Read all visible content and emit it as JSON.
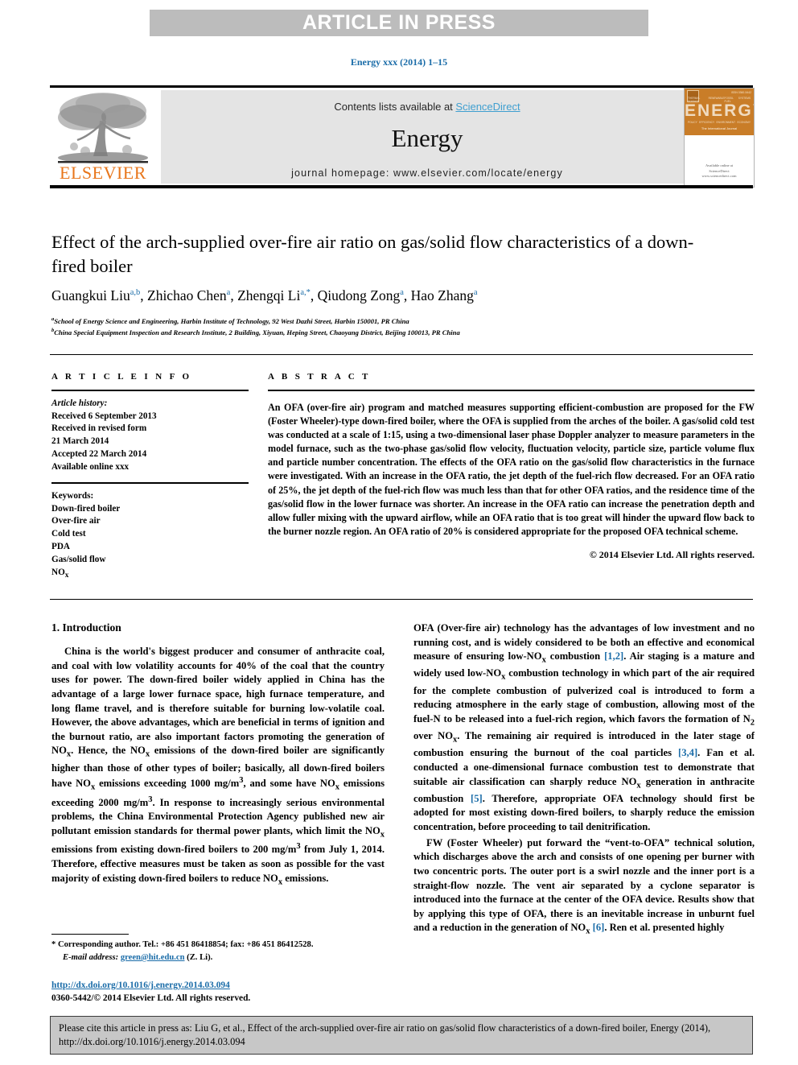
{
  "banner": {
    "label": "ARTICLE IN PRESS"
  },
  "running_head": "Energy xxx (2014) 1–15",
  "masthead": {
    "contents_prefix": "Contents lists available at ",
    "sciencedirect": "ScienceDirect",
    "journal_name": "Energy",
    "homepage": "journal homepage: www.elsevier.com/locate/energy",
    "publisher_wordmark": "ELSEVIER",
    "cover": {
      "title_word": "ENERGY",
      "subtitle": "The International Journal",
      "corner_label": "ISSN 0360-5442",
      "top_row": [
        "THERMAL SCIENCE",
        "RENEWABLE",
        "FOSSIL FUEL",
        "SYSTEMS"
      ],
      "bottom_row": [
        "POLICY",
        "EFFICIENCY",
        "ENVIRONMENT",
        "ECONOMY"
      ],
      "publisher_lines": "Available online at\nScienceDirect\nwww.sciencedirect.com"
    }
  },
  "article": {
    "title": "Effect of the arch-supplied over-fire air ratio on gas/solid flow characteristics of a down-fired boiler",
    "authors": [
      {
        "name": "Guangkui Liu",
        "marks": "a,b",
        "sep": ", "
      },
      {
        "name": "Zhichao Chen",
        "marks": "a",
        "sep": ", "
      },
      {
        "name": "Zhengqi Li",
        "marks": "a,*",
        "sep": ", "
      },
      {
        "name": "Qiudong Zong",
        "marks": "a",
        "sep": ", "
      },
      {
        "name": "Hao Zhang",
        "marks": "a",
        "sep": ""
      }
    ],
    "affiliations": [
      {
        "mark": "a",
        "text": "School of Energy Science and Engineering, Harbin Institute of Technology, 92 West Dazhi Street, Harbin 150001, PR China"
      },
      {
        "mark": "b",
        "text": "China Special Equipment Inspection and Research Institute, 2 Building, Xiyuan, Heping Street, Chaoyang District, Beijing 100013, PR China"
      }
    ]
  },
  "article_info": {
    "heading": "A R T I C L E   I N F O",
    "history_label": "Article history:",
    "history": [
      "Received 6 September 2013",
      "Received in revised form",
      "21 March 2014",
      "Accepted 22 March 2014",
      "Available online xxx"
    ],
    "keywords_label": "Keywords:",
    "keywords": [
      "Down-fired boiler",
      "Over-fire air",
      "Cold test",
      "PDA",
      "Gas/solid flow",
      "NOx"
    ]
  },
  "abstract": {
    "heading": "A B S T R A C T",
    "text": "An OFA (over-fire air) program and matched measures supporting efficient-combustion are proposed for the FW (Foster Wheeler)-type down-fired boiler, where the OFA is supplied from the arches of the boiler. A gas/solid cold test was conducted at a scale of 1:15, using a two-dimensional laser phase Doppler analyzer to measure parameters in the model furnace, such as the two-phase gas/solid flow velocity, fluctuation velocity, particle size, particle volume flux and particle number concentration. The effects of the OFA ratio on the gas/solid flow characteristics in the furnace were investigated. With an increase in the OFA ratio, the jet depth of the fuel-rich flow decreased. For an OFA ratio of 25%, the jet depth of the fuel-rich flow was much less than that for other OFA ratios, and the residence time of the gas/solid flow in the lower furnace was shorter. An increase in the OFA ratio can increase the penetration depth and allow fuller mixing with the upward airflow, while an OFA ratio that is too great will hinder the upward flow back to the burner nozzle region. An OFA ratio of 20% is considered appropriate for the proposed OFA technical scheme.",
    "copyright": "© 2014 Elsevier Ltd. All rights reserved."
  },
  "body": {
    "section_heading": "1. Introduction",
    "left_paragraphs": [
      "China is the world's biggest producer and consumer of anthracite coal, and coal with low volatility accounts for 40% of the coal that the country uses for power. The down-fired boiler widely applied in China has the advantage of a large lower furnace space, high furnace temperature, and long flame travel, and is therefore suitable for burning low-volatile coal. However, the above advantages, which are beneficial in terms of ignition and the burnout ratio, are also important factors promoting the generation of NOx. Hence, the NOx emissions of the down-fired boiler are significantly higher than those of other types of boiler; basically, all down-fired boilers have NOx emissions exceeding 1000 mg/m3, and some have NOx emissions exceeding 2000 mg/m3. In response to increasingly serious environmental problems, the China Environmental Protection Agency published new air pollutant emission standards for thermal power plants, which limit the NOx emissions from existing down-fired boilers to 200 mg/m3 from July 1, 2014. Therefore, effective measures must be taken as soon as possible for the vast majority of existing down-fired boilers to reduce NOx emissions."
    ],
    "right_paragraphs": [
      "OFA (Over-fire air) technology has the advantages of low investment and no running cost, and is widely considered to be both an effective and economical measure of ensuring low-NOx combustion [1,2]. Air staging is a mature and widely used low-NOx combustion technology in which part of the air required for the complete combustion of pulverized coal is introduced to form a reducing atmosphere in the early stage of combustion, allowing most of the fuel-N to be released into a fuel-rich region, which favors the formation of N2 over NOx. The remaining air required is introduced in the later stage of combustion ensuring the burnout of the coal particles [3,4]. Fan et al. conducted a one-dimensional furnace combustion test to demonstrate that suitable air classification can sharply reduce NOx generation in anthracite combustion [5]. Therefore, appropriate OFA technology should first be adopted for most existing down-fired boilers, to sharply reduce the emission concentration, before proceeding to tail denitrification.",
      "FW (Foster Wheeler) put forward the “vent-to-OFA” technical solution, which discharges above the arch and consists of one opening per burner with two concentric ports. The outer port is a swirl nozzle and the inner port is a straight-flow nozzle. The vent air separated by a cyclone separator is introduced into the furnace at the center of the OFA device. Results show that by applying this type of OFA, there is an inevitable increase in unburnt fuel and a reduction in the generation of NOx [6]. Ren et al. presented highly"
    ]
  },
  "footnote": {
    "corresponding": "* Corresponding author. Tel.: +86 451 86418854; fax: +86 451 86412528.",
    "email_label": "E-mail address:",
    "email": "green@hit.edu.cn",
    "email_suffix": "(Z. Li).",
    "doi": "http://dx.doi.org/10.1016/j.energy.2014.03.094",
    "issn_line": "0360-5442/© 2014 Elsevier Ltd. All rights reserved."
  },
  "cite_box": {
    "text": "Please cite this article in press as: Liu G, et al., Effect of the arch-supplied over-fire air ratio on gas/solid flow characteristics of a down-fired boiler, Energy (2014), http://dx.doi.org/10.1016/j.energy.2014.03.094"
  },
  "colors": {
    "banner_bg": "#bcbcbc",
    "link_blue": "#1a6ca8",
    "sciencedirect_blue": "#3f9fd0",
    "elsevier_orange": "#e8761b",
    "masthead_gray": "#e4e4e4",
    "cite_box_gray": "#c7c7c7"
  }
}
